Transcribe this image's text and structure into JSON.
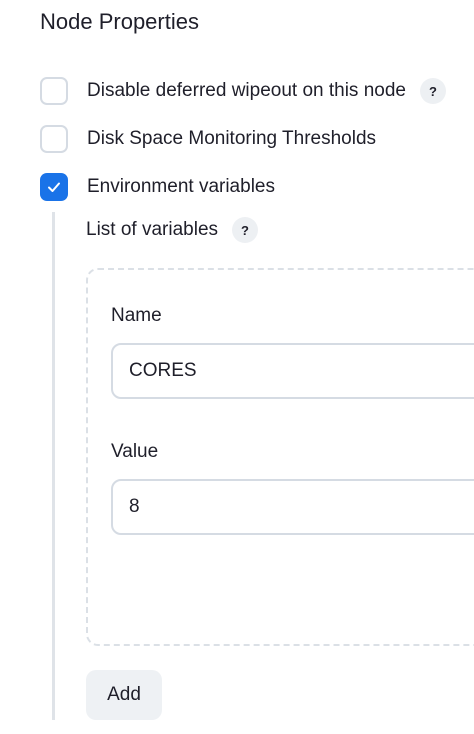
{
  "section": {
    "title": "Node Properties"
  },
  "options": [
    {
      "label": "Disable deferred wipeout on this node",
      "checked": false,
      "help": "?"
    },
    {
      "label": "Disk Space Monitoring Thresholds",
      "checked": false
    },
    {
      "label": "Environment variables",
      "checked": true
    }
  ],
  "env_vars": {
    "list_label": "List of variables",
    "help": "?",
    "entries": [
      {
        "name_label": "Name",
        "name_value": "CORES",
        "value_label": "Value",
        "value_value": "8"
      }
    ],
    "add_label": "Add"
  },
  "colors": {
    "accent": "#1a73e8",
    "border": "#d5dbe3",
    "button_bg": "#eef1f4"
  }
}
